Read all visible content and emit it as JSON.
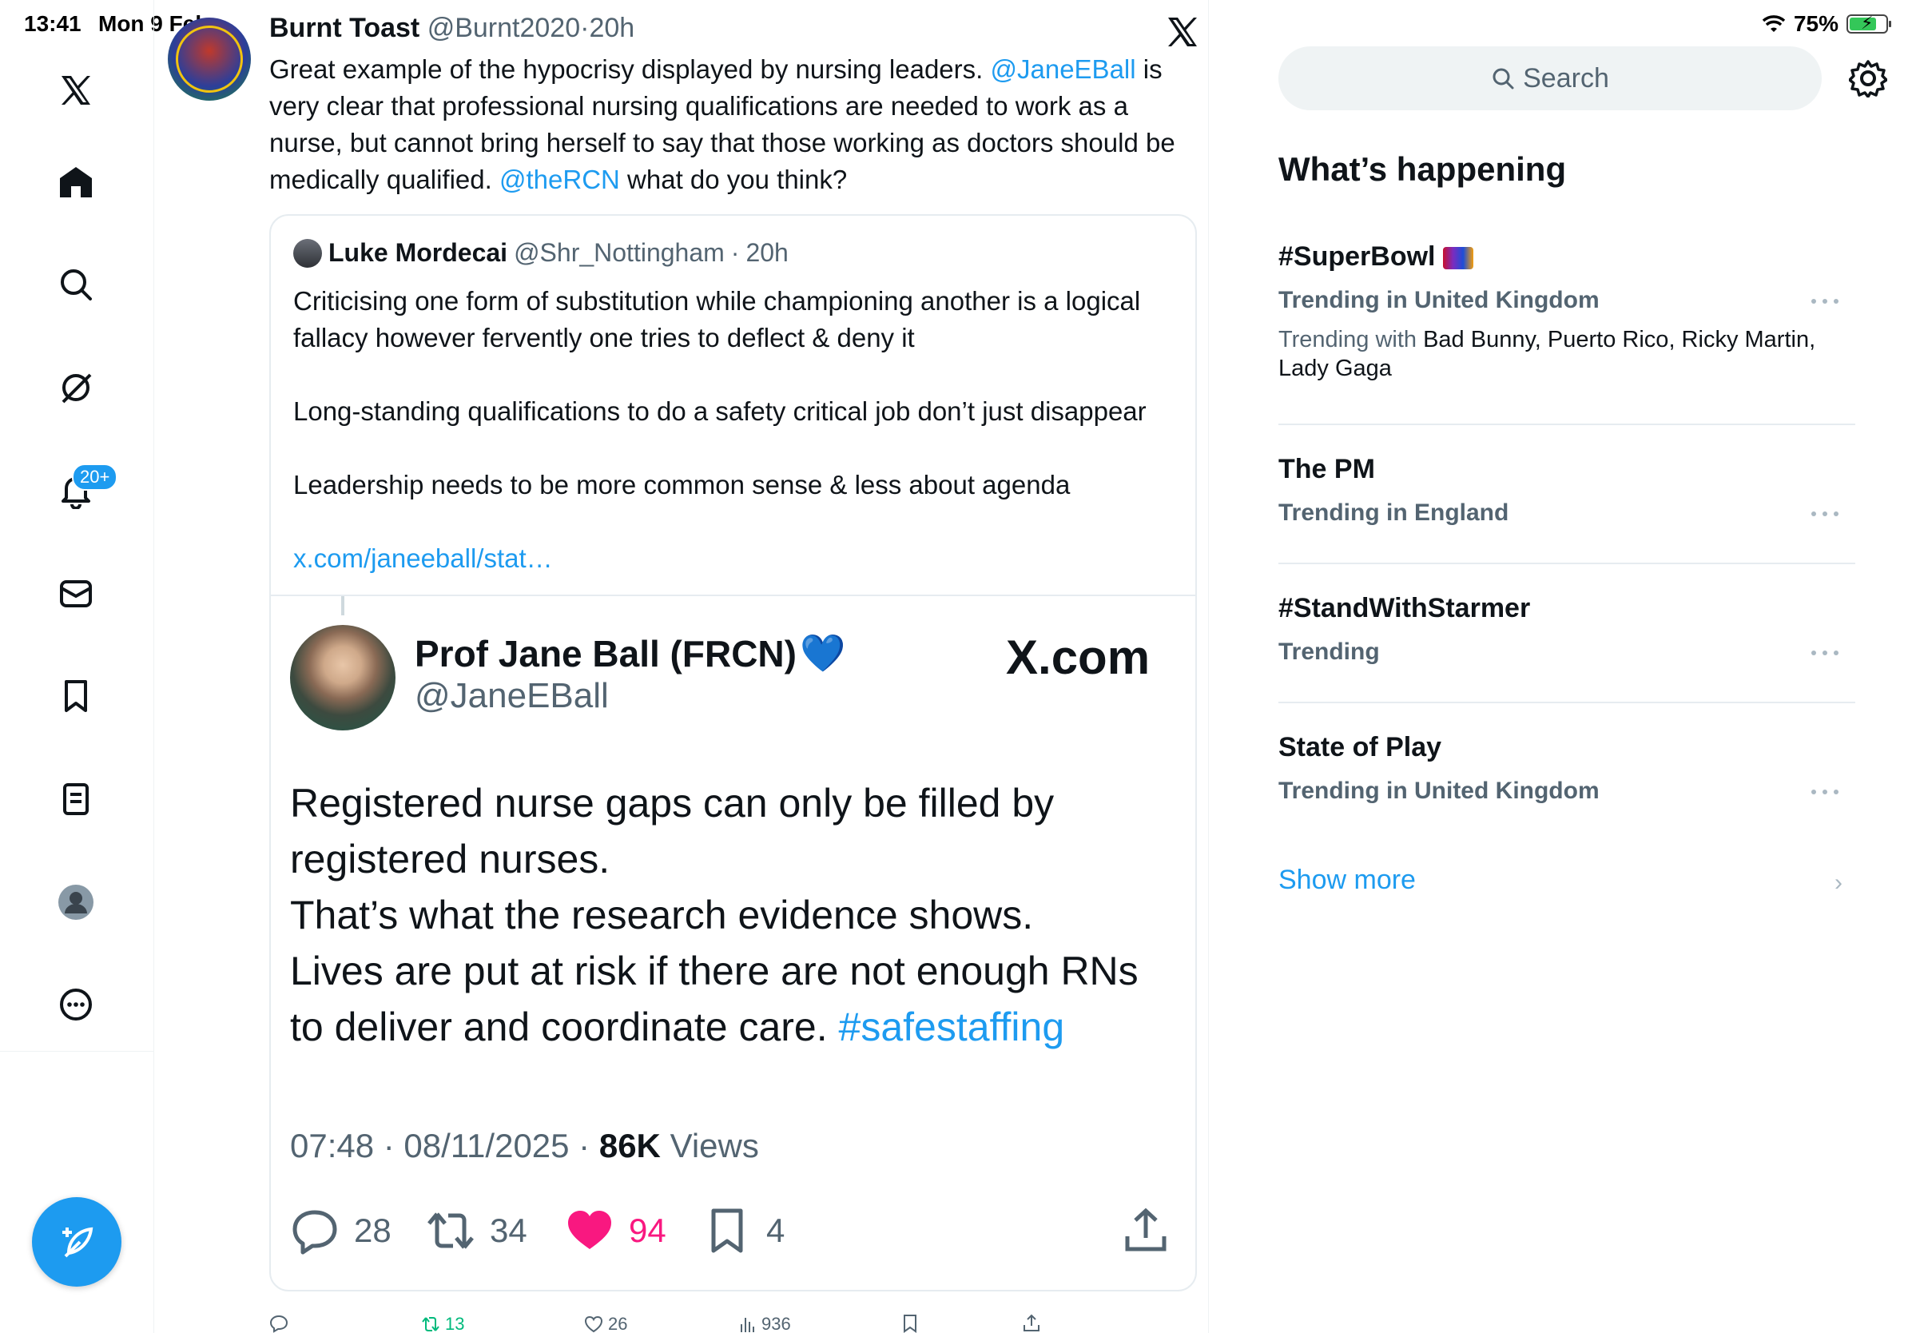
{
  "status": {
    "time": "13:41",
    "date": "Mon 9 Feb",
    "battery": "75%",
    "battery_level": 0.75
  },
  "nav": {
    "notifications_badge": "20+"
  },
  "tweet": {
    "name": "Burnt Toast",
    "handle": "@Burnt2020",
    "time": "20h",
    "text_1": "Great example of the hypocrisy displayed by nursing leaders. ",
    "mention_1": "@JaneEBall",
    "text_2": " is very clear that professional nursing qualifications are needed to work as a nurse, but cannot bring herself to say that those working as doctors should be medically qualified. ",
    "mention_2": "@theRCN",
    "text_3": " what do you think?"
  },
  "quote": {
    "name": "Luke Mordecai",
    "handle": "@Shr_Nottingham",
    "time": "20h",
    "para_1": "Criticising one form of substitution while championing another is a logical fallacy however fervently one tries to deflect & deny it",
    "para_2": "Long-standing qualifications to do a safety critical job don’t just disappear",
    "para_3": "Leadership needs to be more common sense & less about agenda",
    "link": "x.com/janeeball/stat…"
  },
  "embedded": {
    "name": "Prof Jane Ball (FRCN)",
    "heart": "💙",
    "handle": "@JaneEBall",
    "brand": "X.com",
    "text": "Registered nurse gaps can only be filled by registered nurses.\nThat’s what the research evidence shows.\nLives are put at risk if there are not enough RNs to deliver and coordinate care. ",
    "hashtag": "#safestaffing",
    "meta_time": "07:48 · 08/11/2025 · ",
    "views_count": "86K",
    "views_label": " Views",
    "replies": "28",
    "reposts": "34",
    "likes": "94",
    "bookmarks": "4"
  },
  "tweet_actions": {
    "reposts": "13",
    "likes": "26",
    "views": "936"
  },
  "sidebar": {
    "search_placeholder": "Search",
    "heading": "What’s happening",
    "trends": [
      {
        "title": "#SuperBowl",
        "subtitle": "Trending in United Kingdom",
        "with_label": "Trending with ",
        "with_names": "Bad Bunny, Puerto Rico, Ricky Martin, Lady Gaga"
      },
      {
        "title": "The PM",
        "subtitle": "Trending in England"
      },
      {
        "title": "#StandWithStarmer",
        "subtitle": "Trending"
      },
      {
        "title": "State of Play",
        "subtitle": "Trending in United Kingdom"
      }
    ],
    "show_more": "Show more"
  }
}
